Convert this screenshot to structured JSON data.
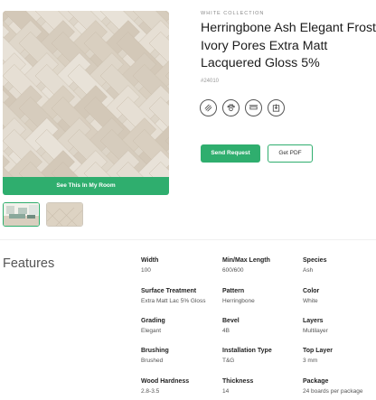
{
  "product": {
    "collection": "WHITE COLLECTION",
    "title": "Herringbone Ash Elegant Frost Ivory Pores Extra Matt Lacquered Gloss 5%",
    "sku": "#24010",
    "see_room_label": "See This In My Room",
    "send_request_label": "Send Request",
    "get_pdf_label": "Get PDF",
    "feature_icons": [
      "underfloor-heating-icon",
      "pet-friendly-icon",
      "dimensions-icon",
      "install-icon"
    ],
    "colors": {
      "accent": "#2fae6e",
      "wood_light": "#e2dbcf",
      "wood_dark": "#cbbfae"
    }
  },
  "features": {
    "heading": "Features",
    "specs": [
      {
        "label": "Width",
        "value": "100"
      },
      {
        "label": "Min/Max Length",
        "value": "600/600"
      },
      {
        "label": "Species",
        "value": "Ash"
      },
      {
        "label": "Surface Treatment",
        "value": "Extra Matt Lac 5% Gloss"
      },
      {
        "label": "Pattern",
        "value": "Herringbone"
      },
      {
        "label": "Color",
        "value": "White"
      },
      {
        "label": "Grading",
        "value": "Elegant"
      },
      {
        "label": "Bevel",
        "value": "4B"
      },
      {
        "label": "Layers",
        "value": "Multilayer"
      },
      {
        "label": "Brushing",
        "value": "Brushed"
      },
      {
        "label": "Installation Type",
        "value": "T&G"
      },
      {
        "label": "Top Layer",
        "value": "3 mm"
      },
      {
        "label": "Wood Hardness",
        "value": "2.8-3.5"
      },
      {
        "label": "Thickness",
        "value": "14"
      },
      {
        "label": "Package",
        "value": "24 boards per package"
      }
    ]
  }
}
